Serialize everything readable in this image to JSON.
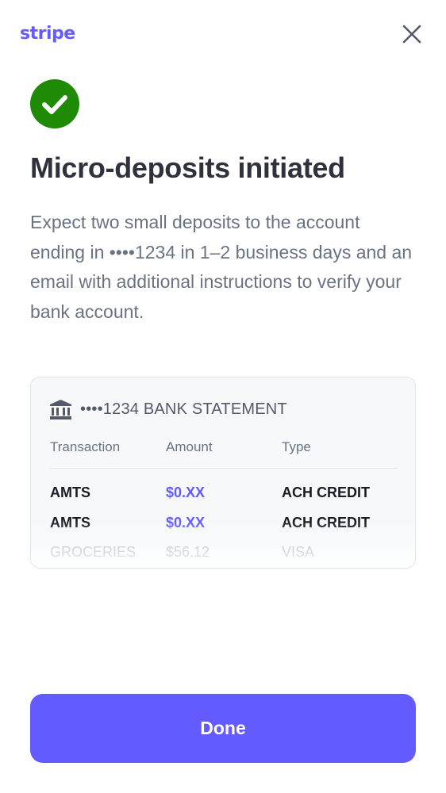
{
  "header": {
    "logo_text": "stripe",
    "close_icon": "close-icon"
  },
  "colors": {
    "brand": "#635bff",
    "success": "#1f8a06",
    "text_primary": "#30313d",
    "text_secondary": "#6a7383"
  },
  "main": {
    "status_icon": "checkmark-circle-icon",
    "title": "Micro-deposits initiated",
    "description": "Expect two small deposits to the account ending in ••••1234 in 1–2 business days and an email with additional instructions to verify your bank account."
  },
  "statement": {
    "icon": "bank-icon",
    "title": "••••1234 BANK STATEMENT",
    "columns": [
      "Transaction",
      "Amount",
      "Type"
    ],
    "rows": [
      {
        "transaction": "AMTS",
        "amount": "$0.XX",
        "type": "ACH CREDIT"
      },
      {
        "transaction": "AMTS",
        "amount": "$0.XX",
        "type": "ACH CREDIT"
      },
      {
        "transaction": "GROCERIES",
        "amount": "$56.12",
        "type": "VISA"
      }
    ]
  },
  "footer": {
    "done_label": "Done"
  }
}
